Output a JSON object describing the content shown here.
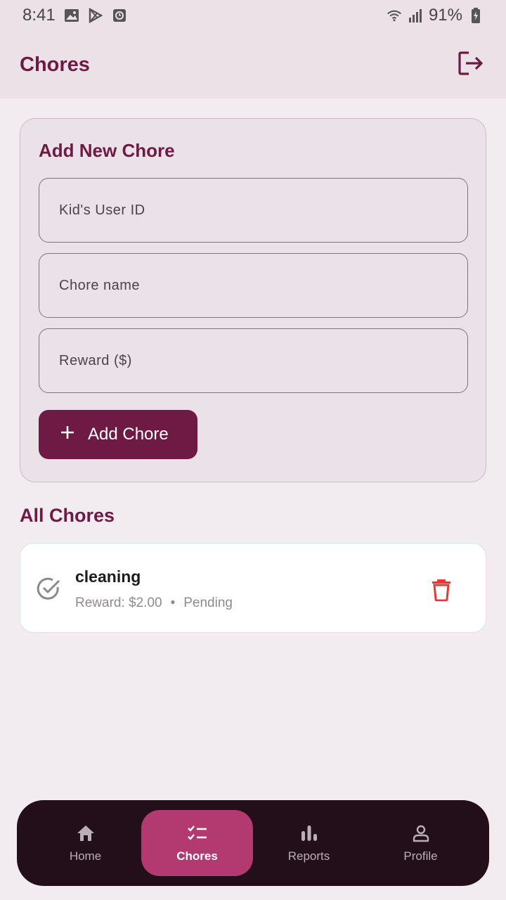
{
  "status_bar": {
    "time": "8:41",
    "battery": "91%",
    "icons": [
      "image-icon",
      "play-store-icon",
      "clock-icon",
      "wifi-icon",
      "signal-icon",
      "battery-charging-icon"
    ]
  },
  "app_bar": {
    "title": "Chores",
    "logout_icon": "logout-icon"
  },
  "add_card": {
    "title": "Add New Chore",
    "fields": [
      {
        "placeholder": "Kid's User ID",
        "value": ""
      },
      {
        "placeholder": "Chore name",
        "value": ""
      },
      {
        "placeholder": "Reward ($)",
        "value": ""
      }
    ],
    "button_label": "Add Chore",
    "button_icon": "plus-icon"
  },
  "all_chores": {
    "title": "All Chores",
    "items": [
      {
        "name": "cleaning",
        "reward": "Reward: $2.00",
        "separator": "•",
        "status": "Pending"
      }
    ]
  },
  "bottom_nav": {
    "items": [
      {
        "label": "Home",
        "icon": "home-icon",
        "active": false
      },
      {
        "label": "Chores",
        "icon": "checklist-icon",
        "active": true
      },
      {
        "label": "Reports",
        "icon": "bar-chart-icon",
        "active": false
      },
      {
        "label": "Profile",
        "icon": "person-icon",
        "active": false
      }
    ]
  },
  "colors": {
    "primary": "#6e1a45",
    "nav_background": "#230f1a",
    "nav_active": "#b23a70",
    "delete": "#e53935"
  }
}
